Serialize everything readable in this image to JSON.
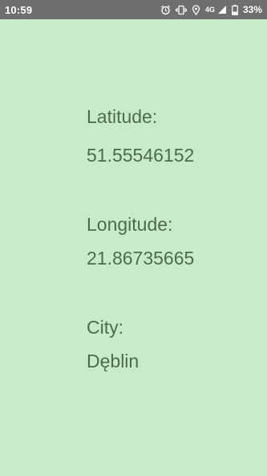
{
  "status_bar": {
    "time": "10:59",
    "network_type": "4G",
    "battery_percent": "33%",
    "icons": [
      "alarm-icon",
      "vibrate-icon",
      "location-icon",
      "network-4g-icon",
      "signal-icon",
      "battery-icon"
    ]
  },
  "location": {
    "latitude_label": "Latitude:",
    "latitude_value": "51.55546152",
    "longitude_label": "Longitude:",
    "longitude_value": "21.86735665",
    "city_label": "City:",
    "city_value": "Dęblin"
  },
  "colors": {
    "background": "#c8ecca",
    "status_bar": "#6f6f6f",
    "text": "#4f6b4f"
  }
}
